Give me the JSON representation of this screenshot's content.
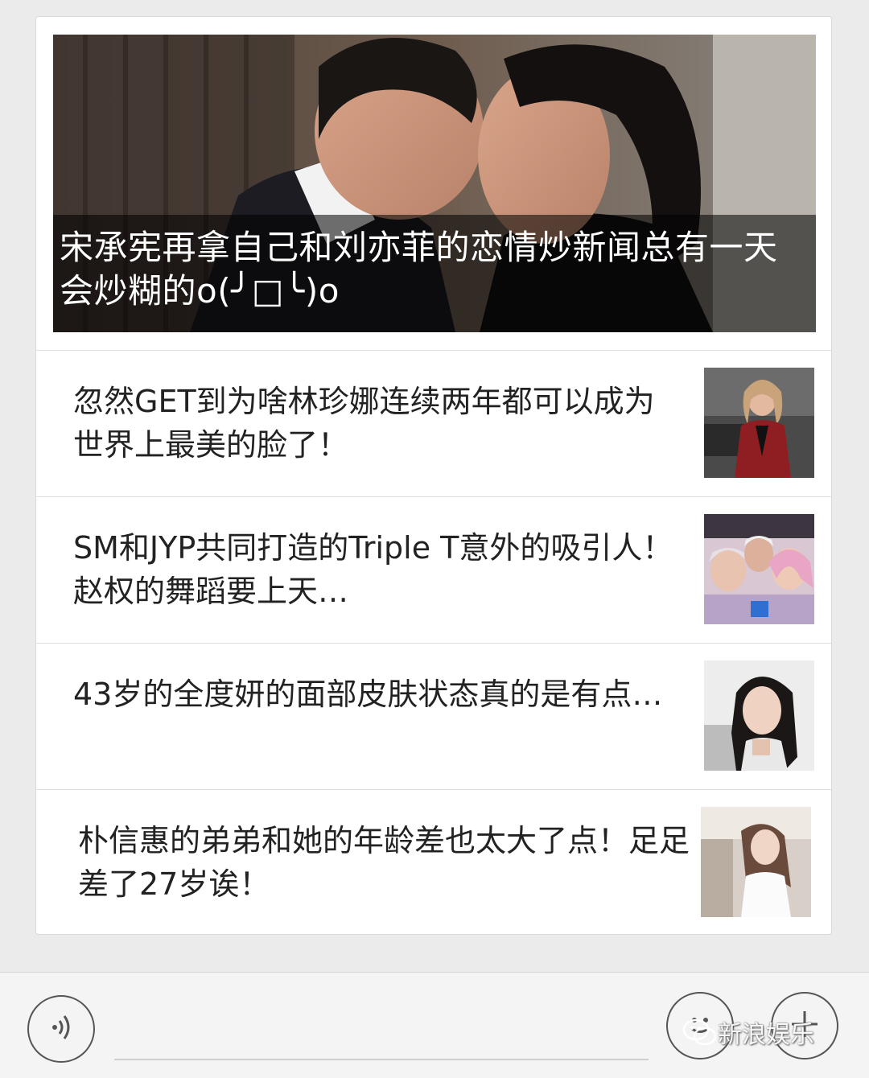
{
  "cover": {
    "title": "宋承宪再拿自己和刘亦菲的恋情炒新闻总有一天会炒糊的o(╯□╰)o"
  },
  "articles": [
    {
      "title": "忽然GET到为啥林珍娜连续两年都可以成为世界上最美的脸了！",
      "thumb": "thumbnail-woman-red-jacket"
    },
    {
      "title": "SM和JYP共同打造的Triple T意外的吸引人！赵权的舞蹈要上天…",
      "thumb": "thumbnail-group-selfie"
    },
    {
      "title": "43岁的全度妍的面部皮肤状态真的是有点…",
      "thumb": "thumbnail-smiling-woman"
    },
    {
      "title": "朴信惠的弟弟和她的年龄差也太大了点！足足差了27岁诶！",
      "thumb": "thumbnail-woman-white-shirt"
    }
  ],
  "bottom_bar": {
    "voice_icon": "voice-input-icon",
    "emoji_icon": "emoji-icon",
    "plus_icon": "plus-icon"
  },
  "watermark": {
    "text": "新浪娱乐"
  }
}
